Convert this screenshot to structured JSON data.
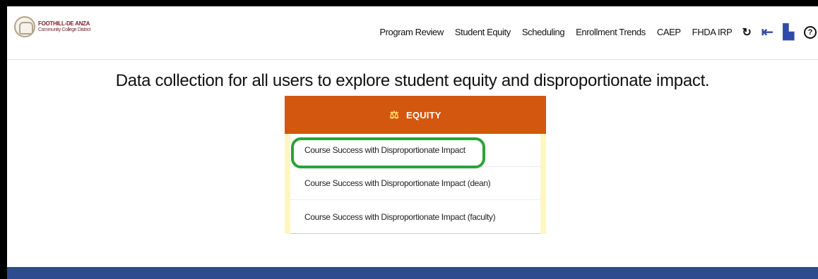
{
  "logo": {
    "line1": "FOOTHILL-DE ANZA",
    "line2": "Community College District"
  },
  "nav": {
    "items": [
      "Program Review",
      "Student Equity",
      "Scheduling",
      "Enrollment Trends",
      "CAEP",
      "FHDA IRP"
    ],
    "icons": [
      "refresh-icon",
      "menu-collapse-icon",
      "document-icon",
      "help-icon"
    ]
  },
  "headline": "Data collection for all users to explore student equity and disproportionate impact.",
  "card": {
    "title": "EQUITY",
    "icon": "scale-icon",
    "items": [
      "Course Success with Disproportionate Impact",
      "Course Success with Disproportionate Impact (dean)",
      "Course Success with Disproportionate Impact (faculty)"
    ]
  },
  "colors": {
    "header": "#d3570f",
    "card_body": "#fdf6c4",
    "highlight": "#2aa336",
    "footer": "#2e4b8f"
  }
}
